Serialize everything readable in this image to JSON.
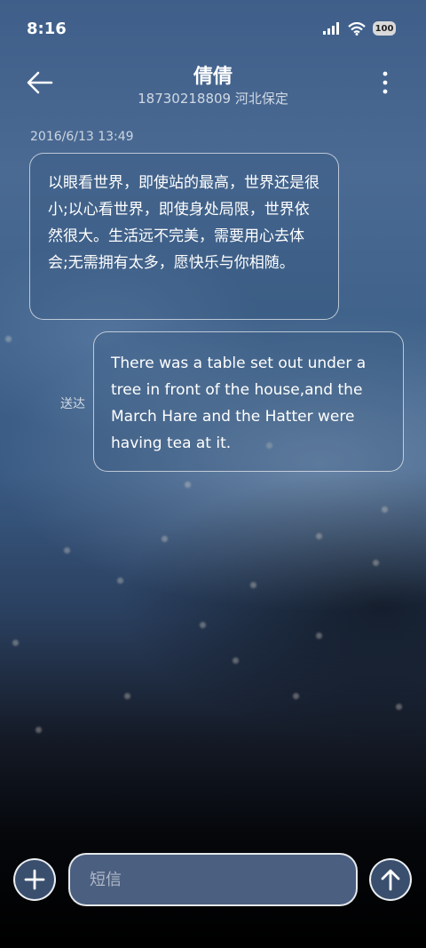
{
  "status_bar": {
    "time": "8:16",
    "battery": "100"
  },
  "header": {
    "back_icon": "arrow-left-icon",
    "contact_name": "倩倩",
    "contact_sub": "18730218809 河北保定",
    "more_icon": "more-vertical-icon"
  },
  "messages": [
    {
      "direction": "incoming",
      "timestamp": "2016/6/13 13:49",
      "text": "以眼看世界，即使站的最高，世界还是很小;以心看世界，即使身处局限，世界依然很大。生活远不完美，需要用心去体会;无需拥有太多，愿快乐与你相随。"
    },
    {
      "direction": "outgoing",
      "status": "送达",
      "text": "There was a table set out under a tree in front of the house,and the March Hare and the Hatter were having tea at it."
    }
  ],
  "composer": {
    "add_icon": "plus-icon",
    "placeholder": "短信",
    "value": "",
    "send_icon": "arrow-up-icon"
  }
}
